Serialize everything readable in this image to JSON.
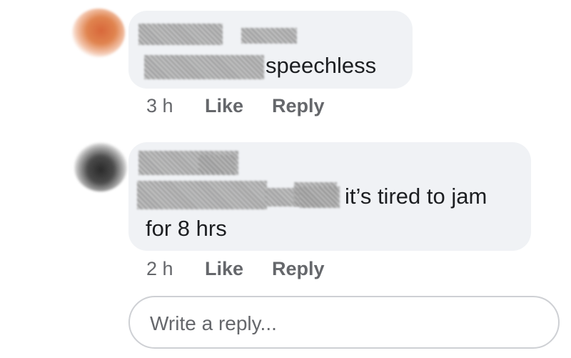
{
  "comments": [
    {
      "text": "speechless",
      "time": "3 h",
      "like_label": "Like",
      "reply_label": "Reply"
    },
    {
      "text_line1": "it’s tired to jam",
      "text_line2": "for 8 hrs",
      "time": "2 h",
      "like_label": "Like",
      "reply_label": "Reply"
    }
  ],
  "reply_input": {
    "placeholder": "Write a reply..."
  }
}
